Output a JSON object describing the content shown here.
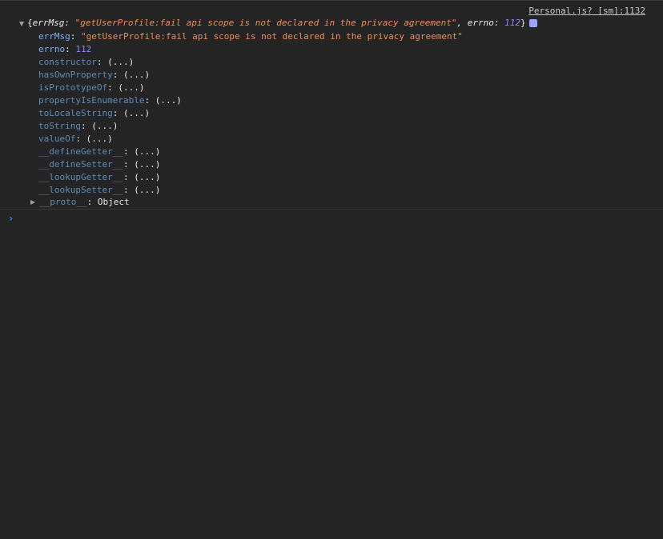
{
  "source_link": "Personal.js? [sm]:1132",
  "summary": {
    "open_brace": "{",
    "errMsg_key": "errMsg",
    "colon_sep": ": ",
    "errMsg_value": "\"getUserProfile:fail api scope is not declared in the privacy agreement\"",
    "comma_sep": ", ",
    "errno_key": "errno",
    "errno_value": "112",
    "close_brace": "}"
  },
  "properties": [
    {
      "key": "errMsg",
      "sep": ": ",
      "value": "\"getUserProfile:fail api scope is not declared in the privacy agreement\"",
      "kind": "string",
      "own": true
    },
    {
      "key": "errno",
      "sep": ": ",
      "value": "112",
      "kind": "number",
      "own": true
    },
    {
      "key": "constructor",
      "sep": ": ",
      "value": "(...)",
      "kind": "getter",
      "own": false
    },
    {
      "key": "hasOwnProperty",
      "sep": ": ",
      "value": "(...)",
      "kind": "getter",
      "own": false
    },
    {
      "key": "isPrototypeOf",
      "sep": ": ",
      "value": "(...)",
      "kind": "getter",
      "own": false
    },
    {
      "key": "propertyIsEnumerable",
      "sep": ": ",
      "value": "(...)",
      "kind": "getter",
      "own": false
    },
    {
      "key": "toLocaleString",
      "sep": ": ",
      "value": "(...)",
      "kind": "getter",
      "own": false
    },
    {
      "key": "toString",
      "sep": ": ",
      "value": "(...)",
      "kind": "getter",
      "own": false
    },
    {
      "key": "valueOf",
      "sep": ": ",
      "value": "(...)",
      "kind": "getter",
      "own": false
    },
    {
      "key": "__defineGetter__",
      "sep": ": ",
      "value": "(...)",
      "kind": "getter",
      "own": false
    },
    {
      "key": "__defineSetter__",
      "sep": ": ",
      "value": "(...)",
      "kind": "getter",
      "own": false
    },
    {
      "key": "__lookupGetter__",
      "sep": ": ",
      "value": "(...)",
      "kind": "getter",
      "own": false
    },
    {
      "key": "__lookupSetter__",
      "sep": ": ",
      "value": "(...)",
      "kind": "getter",
      "own": false
    }
  ],
  "proto": {
    "key": "__proto__",
    "sep": ": ",
    "value": "Object"
  },
  "prompt_symbol": "›",
  "icons": {
    "expand": "triangle-down-icon",
    "collapse": "triangle-right-icon",
    "info": "info-badge-icon",
    "prompt": "chevron-right-icon"
  },
  "colors": {
    "background": "#242424",
    "string": "#f28b54",
    "number": "#9980ff",
    "own_key": "#7cacf8",
    "inherited_key": "#5d8bb8",
    "prompt": "#4e8cff"
  }
}
